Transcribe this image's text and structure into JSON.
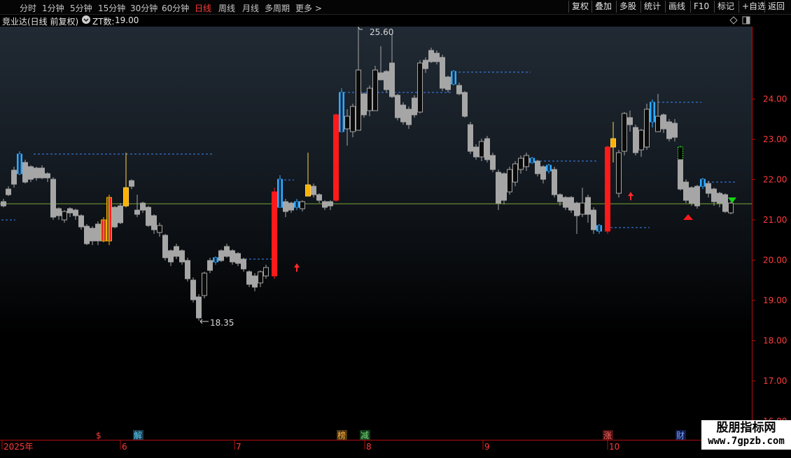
{
  "toolbar": {
    "timeframes": [
      "分时",
      "1分钟",
      "5分钟",
      "15分钟",
      "30分钟",
      "60分钟",
      "日线",
      "周线",
      "月线",
      "多周期",
      "更多 >"
    ],
    "active": "日线",
    "right_buttons": [
      "复权",
      "叠加",
      "多股",
      "统计",
      "画线",
      "F10",
      "标记",
      "+自选",
      "返回"
    ]
  },
  "info": {
    "stock": "竞业达(日线 前复权)",
    "indicator_label": "ZT数:",
    "indicator_value": "19.00"
  },
  "price_axis": {
    "ticks": [
      "24.00",
      "23.00",
      "22.00",
      "21.00",
      "20.00",
      "19.00",
      "18.00",
      "17.00",
      "16.00"
    ],
    "min": 16.0,
    "max": 24.0
  },
  "annotations": {
    "high": "25.60",
    "low": "18.35"
  },
  "date_axis": {
    "labels": [
      "2025年",
      "6",
      "7",
      "8",
      "9",
      "10"
    ]
  },
  "event_markers": [
    "$",
    "解",
    "榜",
    "减",
    "涨",
    "财"
  ],
  "colors": {
    "up": "#ff1a1a",
    "down": "#a6a6a6",
    "ma": "#9fd93b",
    "dotted": "#3a86ff",
    "highlight": "#33aaff"
  },
  "watermark": {
    "line1": "股朋指标网",
    "line2": "www.7gpzb.com"
  }
}
